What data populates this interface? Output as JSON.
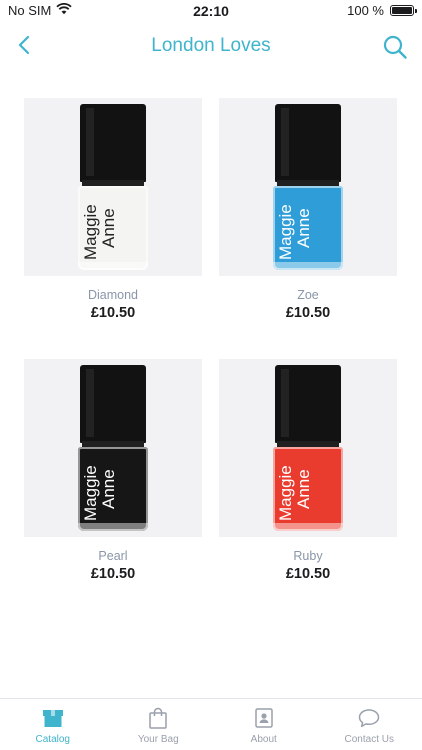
{
  "status_bar": {
    "carrier": "No SIM",
    "time": "22:10",
    "battery": "100 %"
  },
  "nav": {
    "title": "London Loves",
    "back_icon": "chevron-left-icon",
    "search_icon": "search-icon"
  },
  "colors": {
    "accent": "#3fb4cc",
    "muted_text": "#8a96a8",
    "card_bg": "#f2f2f4"
  },
  "products": [
    {
      "name": "Diamond",
      "price": "£10.50",
      "brand_line1": "Maggie",
      "brand_line2": "Anne",
      "polish_color": "#f4f5f2",
      "brand_color": "#222222"
    },
    {
      "name": "Zoe",
      "price": "£10.50",
      "brand_line1": "Maggie",
      "brand_line2": "Anne",
      "polish_color": "#2f9ed8",
      "brand_color": "#ffffff"
    },
    {
      "name": "Pearl",
      "price": "£10.50",
      "brand_line1": "Maggie",
      "brand_line2": "Anne",
      "polish_color": "#161616",
      "brand_color": "#ffffff"
    },
    {
      "name": "Ruby",
      "price": "£10.50",
      "brand_line1": "Maggie",
      "brand_line2": "Anne",
      "polish_color": "#ea3b2f",
      "brand_color": "#ffffff"
    }
  ],
  "tabs": [
    {
      "label": "Catalog",
      "icon": "catalog-box-icon",
      "active": true
    },
    {
      "label": "Your Bag",
      "icon": "shopping-bag-icon",
      "active": false
    },
    {
      "label": "About",
      "icon": "about-contact-icon",
      "active": false
    },
    {
      "label": "Contact Us",
      "icon": "chat-bubble-icon",
      "active": false
    }
  ]
}
